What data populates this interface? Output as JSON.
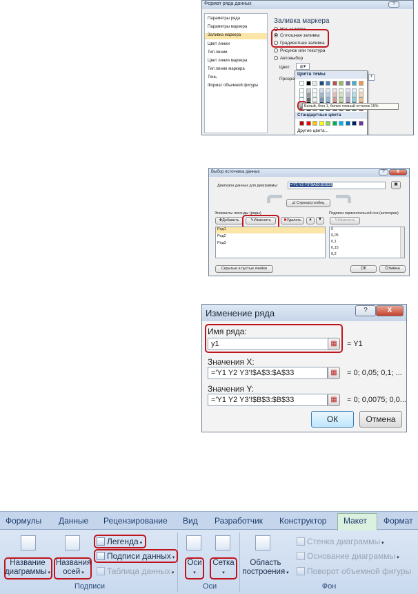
{
  "format_dialog": {
    "title": "Формат ряда данных",
    "nav": [
      "Параметры ряда",
      "Параметры маркера",
      "Заливка маркера",
      "Цвет линии",
      "Тип линии",
      "Цвет линии маркера",
      "Тип линии маркера",
      "Тень",
      "Формат объемной фигуры"
    ],
    "selected_nav_index": 2,
    "section_title": "Заливка маркера",
    "radios": [
      "Нет заливки",
      "Сплошная заливка",
      "Градиентная заливка",
      "Рисунок или текстура",
      "Автовыбор"
    ],
    "selected_radio": 1,
    "color_label": "Цвет:",
    "transparency_label": "Прозрач",
    "popup": {
      "theme_colors_label": "Цвета темы",
      "tooltip": "Белый, Фон 1, более темный оттенок 15%",
      "standard_colors_label": "Стандартные цвета",
      "other_colors": "Другие цвета...",
      "theme_top": [
        "#ffffff",
        "#000000",
        "#eeece1",
        "#1f497d",
        "#4f81bd",
        "#c0504d",
        "#9bbb59",
        "#8064a2",
        "#4bacc6",
        "#f79646"
      ],
      "standard": [
        "#c00000",
        "#ff0000",
        "#ffc000",
        "#ffff00",
        "#92d050",
        "#00b050",
        "#00b0f0",
        "#0070c0",
        "#002060",
        "#7030a0"
      ]
    }
  },
  "source_dialog": {
    "title": "Выбор источника данных",
    "range_label": "Диапазон данных для диаграммы:",
    "range_value": "='Y1 Y2 Y3'!$A$3:$D$33",
    "switch_button": "Строка/столбец",
    "legend_label": "Элементы легенды (ряды)",
    "add": "Добавить",
    "change": "Изменить",
    "delete": "Удалить",
    "series": [
      "Ряд1",
      "Ряд2",
      "Ряд3"
    ],
    "axis_label": "Подписи горизонтальной оси (категории)",
    "axis_change": "Изменить",
    "axis_values": [
      "0",
      "0,05",
      "0,1",
      "0,15",
      "0,2"
    ],
    "hidden_cells": "Скрытые и пустые ячейки",
    "ok": "ОК",
    "cancel": "Отмена"
  },
  "edit_series": {
    "title": "Изменение ряда",
    "name_label": "Имя ряда:",
    "name_value": "y1",
    "name_result": "= Y1",
    "x_label": "Значения X:",
    "x_value": "='Y1 Y2 Y3'!$A$3:$A$33",
    "x_result": "= 0; 0,05; 0,1; ...",
    "y_label": "Значения Y:",
    "y_value": "='Y1 Y2 Y3'!$B$3:$B$33",
    "y_result": "= 0; 0,0075; 0,0...",
    "ok": "ОК",
    "cancel": "Отмена",
    "help": "?",
    "close": "X"
  },
  "ribbon": {
    "tabs": [
      "Формулы",
      "Данные",
      "Рецензирование",
      "Вид",
      "Разработчик",
      "Конструктор",
      "Макет",
      "Формат"
    ],
    "active_tab_index": 6,
    "chart_title": [
      "Название",
      "диаграммы"
    ],
    "axis_titles": [
      "Названия",
      "осей"
    ],
    "legend": "Легенда",
    "data_labels": "Подписи данных",
    "data_table": "Таблица данных",
    "labels_group": "Подписи",
    "axes": "Оси",
    "gridlines": "Сетка",
    "axes_group": "Оси",
    "plot_area": [
      "Область",
      "построения"
    ],
    "chart_wall": "Стенка диаграммы",
    "chart_floor": "Основание диаграммы",
    "rotation": "Поворот объемной фигуры",
    "background_group": "Фон"
  }
}
